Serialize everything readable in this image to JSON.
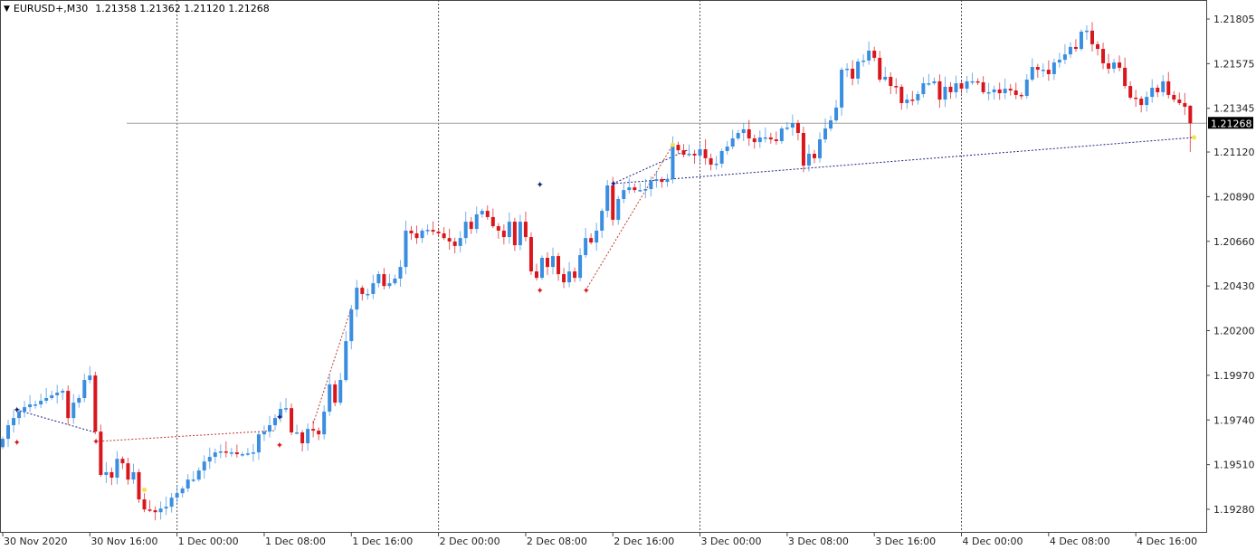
{
  "header": {
    "symbol_timeframe": "EURUSD+,M30",
    "ohlc": "1.21358 1.21362 1.21120 1.21268",
    "menu_icon": "triangle-down-icon"
  },
  "colors": {
    "bull": "#3a8ee0",
    "bear": "#d9161c",
    "grid": "#555555",
    "bid_line": "#a0a0a0",
    "price_tag_bg": "#000000",
    "zigzag_red": "#c0392b",
    "zigzag_blue": "#1a237e",
    "marker_yellow": "#f5e050"
  },
  "chart_data": {
    "type": "candlestick",
    "symbol": "EURUSD+",
    "timeframe": "M30",
    "ylim": [
      1.1916,
      1.219
    ],
    "y_ticks": [
      "1.21805",
      "1.21575",
      "1.21345",
      "1.21120",
      "1.20890",
      "1.20660",
      "1.20430",
      "1.20200",
      "1.19970",
      "1.19740",
      "1.19510",
      "1.19280"
    ],
    "x_ticks": [
      {
        "bar": 0,
        "label": "30 Nov 2020"
      },
      {
        "bar": 16,
        "label": "30 Nov 16:00"
      },
      {
        "bar": 32,
        "label": "1 Dec 00:00"
      },
      {
        "bar": 48,
        "label": "1 Dec 08:00"
      },
      {
        "bar": 64,
        "label": "1 Dec 16:00"
      },
      {
        "bar": 80,
        "label": "2 Dec 00:00"
      },
      {
        "bar": 96,
        "label": "2 Dec 08:00"
      },
      {
        "bar": 112,
        "label": "2 Dec 16:00"
      },
      {
        "bar": 128,
        "label": "3 Dec 00:00"
      },
      {
        "bar": 144,
        "label": "3 Dec 08:00"
      },
      {
        "bar": 160,
        "label": "3 Dec 16:00"
      },
      {
        "bar": 176,
        "label": "4 Dec 00:00"
      },
      {
        "bar": 192,
        "label": "4 Dec 08:00"
      },
      {
        "bar": 208,
        "label": "4 Dec 16:00"
      }
    ],
    "period_separators_bars": [
      32,
      80,
      128,
      176
    ],
    "first_open": 1.196,
    "closes": [
      1.19643,
      1.19713,
      1.1975,
      1.19783,
      1.19806,
      1.1982,
      1.1982,
      1.19839,
      1.19853,
      1.19867,
      1.19881,
      1.1989,
      1.1975,
      1.19829,
      1.19853,
      1.19946,
      1.19969,
      1.1968,
      1.19457,
      1.19471,
      1.19443,
      1.1954,
      1.19517,
      1.19433,
      1.19471,
      1.19331,
      1.19279,
      1.19275,
      1.19265,
      1.19284,
      1.19293,
      1.1934,
      1.19363,
      1.19387,
      1.19433,
      1.19433,
      1.1948,
      1.19526,
      1.1955,
      1.19573,
      1.19578,
      1.19573,
      1.19573,
      1.19564,
      1.19564,
      1.19568,
      1.19573,
      1.19666,
      1.1968,
      1.19713,
      1.1975,
      1.19797,
      1.19801,
      1.19676,
      1.19676,
      1.1962,
      1.19694,
      1.19685,
      1.19666,
      1.19783,
      1.19923,
      1.19829,
      1.19946,
      1.20146,
      1.20309,
      1.20421,
      1.20389,
      1.20389,
      1.20444,
      1.20491,
      1.2043,
      1.20444,
      1.20468,
      1.20528,
      1.20715,
      1.20701,
      1.20677,
      1.20715,
      1.20719,
      1.2071,
      1.20701,
      1.20677,
      1.20659,
      1.20636,
      1.20677,
      1.20761,
      1.20724,
      1.20799,
      1.20817,
      1.20785,
      1.20738,
      1.20715,
      1.20682,
      1.20761,
      1.2064,
      1.20761,
      1.20682,
      1.20505,
      1.20472,
      1.20575,
      1.20528,
      1.20584,
      1.20491,
      1.20449,
      1.20505,
      1.20472,
      1.20589,
      1.20677,
      1.20654,
      1.20715,
      1.20817,
      1.20948,
      1.20771,
      1.20878,
      1.20924,
      1.20938,
      1.20924,
      1.20924,
      1.20929,
      1.20971,
      1.2098,
      1.20966,
      1.2098,
      1.21157,
      1.21129,
      1.21106,
      1.21111,
      1.21102,
      1.21134,
      1.21088,
      1.21055,
      1.2106,
      1.21125,
      1.21148,
      1.2119,
      1.21218,
      1.21237,
      1.2119,
      1.21171,
      1.21195,
      1.21195,
      1.21185,
      1.21176,
      1.21241,
      1.21246,
      1.21269,
      1.21218,
      1.2105,
      1.21111,
      1.21088,
      1.21185,
      1.21241,
      1.21283,
      1.21349,
      1.21544,
      1.21549,
      1.21498,
      1.21586,
      1.21591,
      1.21642,
      1.21605,
      1.21493,
      1.21507,
      1.2146,
      1.21456,
      1.21372,
      1.2139,
      1.21386,
      1.21418,
      1.21474,
      1.21474,
      1.21484,
      1.2139,
      1.21456,
      1.21428,
      1.21474,
      1.21446,
      1.21484,
      1.21484,
      1.21479,
      1.21428,
      1.21428,
      1.21442,
      1.21423,
      1.21446,
      1.21437,
      1.21414,
      1.21409,
      1.21493,
      1.21558,
      1.21544,
      1.21544,
      1.21521,
      1.21581,
      1.21595,
      1.21623,
      1.21661,
      1.21651,
      1.2174,
      1.21745,
      1.21675,
      1.21651,
      1.21577,
      1.21549,
      1.21581,
      1.21554,
      1.2146,
      1.214,
      1.21395,
      1.21362,
      1.21404,
      1.21451,
      1.21428,
      1.21484,
      1.21414,
      1.2139,
      1.21372,
      1.21353,
      1.21268
    ],
    "last_bar": {
      "open": 1.21358,
      "high": 1.21362,
      "low": 1.2112,
      "close": 1.21268
    },
    "bid": {
      "price": 1.21268,
      "label": "1.21268"
    },
    "overlays": [
      {
        "name": "zigzag-blue-1",
        "color": "blue",
        "points": [
          [
            2.5,
            1.19792
          ],
          [
            17,
            1.19676
          ]
        ]
      },
      {
        "name": "zigzag-red-1",
        "color": "red",
        "points": [
          [
            17,
            1.19629
          ],
          [
            50,
            1.19685
          ]
        ]
      },
      {
        "name": "zigzag-red-2",
        "color": "red",
        "points": [
          [
            57,
            1.19722
          ],
          [
            64,
            1.20319
          ]
        ]
      },
      {
        "name": "zigzag-red-3",
        "color": "red",
        "points": [
          [
            107,
            1.20407
          ],
          [
            123,
            1.21157
          ]
        ]
      },
      {
        "name": "trendline-blue-1",
        "color": "blue",
        "points": [
          [
            112,
            1.20957
          ],
          [
            218.7,
            1.21195
          ]
        ]
      },
      {
        "name": "trendline-blue-2",
        "color": "blue",
        "points": [
          [
            112,
            1.20957
          ],
          [
            126,
            1.21134
          ]
        ]
      }
    ],
    "markers": [
      {
        "type": "blue",
        "bar": 2.5,
        "price": 1.19792
      },
      {
        "type": "blue",
        "bar": 50.7,
        "price": 1.19755
      },
      {
        "type": "blue",
        "bar": 98.5,
        "price": 1.20952
      },
      {
        "type": "blue",
        "bar": 112,
        "price": 1.20957
      },
      {
        "type": "red",
        "bar": 2.5,
        "price": 1.19624
      },
      {
        "type": "red",
        "bar": 17,
        "price": 1.19629
      },
      {
        "type": "red",
        "bar": 50.7,
        "price": 1.1961
      },
      {
        "type": "red",
        "bar": 98.5,
        "price": 1.20407
      },
      {
        "type": "red",
        "bar": 107,
        "price": 1.20407
      },
      {
        "type": "yellow",
        "bar": 218.7,
        "price": 1.21195
      },
      {
        "type": "yellow",
        "bar": 26,
        "price": 1.1938
      },
      {
        "type": "yellow",
        "bar": 123,
        "price": 1.21157
      }
    ]
  }
}
